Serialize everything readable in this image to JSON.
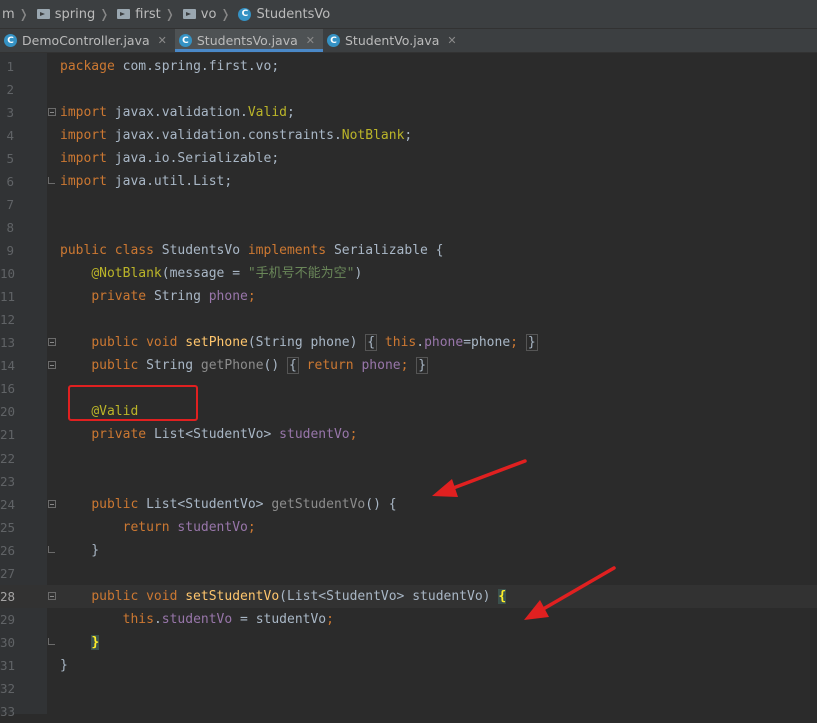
{
  "breadcrumb": [
    {
      "label": "m",
      "icon": "none"
    },
    {
      "label": "spring",
      "icon": "folder-icon"
    },
    {
      "label": "first",
      "icon": "folder-icon"
    },
    {
      "label": "vo",
      "icon": "folder-icon"
    },
    {
      "label": "StudentsVo",
      "icon": "class-icon"
    }
  ],
  "tabs": [
    {
      "label": "DemoController.java",
      "active": false
    },
    {
      "label": "StudentsVo.java",
      "active": true
    },
    {
      "label": "StudentVo.java",
      "active": false
    }
  ],
  "code": {
    "current_line": 28,
    "lines": [
      {
        "n": "1",
        "s": [
          [
            "kw",
            "package "
          ],
          [
            "gray",
            "com.spring.first.vo;"
          ]
        ]
      },
      {
        "n": "2",
        "s": []
      },
      {
        "n": "3",
        "fold": "open",
        "s": [
          [
            "kw",
            "import "
          ],
          [
            "gray",
            "javax.validation."
          ],
          [
            "an",
            "Valid"
          ],
          [
            "gray",
            ";"
          ]
        ]
      },
      {
        "n": "4",
        "s": [
          [
            "kw",
            "import "
          ],
          [
            "gray",
            "javax.validation.constraints."
          ],
          [
            "an",
            "NotBlank"
          ],
          [
            "gray",
            ";"
          ]
        ]
      },
      {
        "n": "5",
        "s": [
          [
            "kw",
            "import "
          ],
          [
            "gray",
            "java.io.Serializable;"
          ]
        ]
      },
      {
        "n": "6",
        "fold": "end",
        "s": [
          [
            "kw",
            "import "
          ],
          [
            "gray",
            "java.util.List;"
          ]
        ]
      },
      {
        "n": "7",
        "s": []
      },
      {
        "n": "8",
        "s": []
      },
      {
        "n": "9",
        "s": [
          [
            "kw",
            "public class "
          ],
          [
            "gray",
            "StudentsVo "
          ],
          [
            "kw",
            "implements "
          ],
          [
            "gray",
            "Serializable {"
          ]
        ]
      },
      {
        "n": "10",
        "s": [
          [
            "gray",
            "    "
          ],
          [
            "an",
            "@NotBlank"
          ],
          [
            "gray",
            "(message = "
          ],
          [
            "str",
            "\"手机号不能为空\""
          ],
          [
            "gray",
            ")"
          ]
        ]
      },
      {
        "n": "11",
        "s": [
          [
            "gray",
            "    "
          ],
          [
            "kw",
            "private "
          ],
          [
            "gray",
            "String "
          ],
          [
            "fd",
            "phone"
          ],
          [
            "kw",
            ";"
          ]
        ]
      },
      {
        "n": "12",
        "s": []
      },
      {
        "n": "13",
        "fold": "open",
        "s": [
          [
            "gray",
            "    "
          ],
          [
            "kw",
            "public void "
          ],
          [
            "fn",
            "setPhone"
          ],
          [
            "gray",
            "(String phone) "
          ],
          [
            "brace",
            "{"
          ],
          [
            "gray",
            " "
          ],
          [
            "kw",
            "this"
          ],
          [
            "gray",
            "."
          ],
          [
            "fd",
            "phone"
          ],
          [
            "gray",
            "=phone"
          ],
          [
            "kw",
            ";"
          ],
          [
            "gray",
            " "
          ],
          [
            "brace",
            "}"
          ]
        ]
      },
      {
        "n": "14",
        "fold": "open",
        "s": [
          [
            "gray",
            "    "
          ],
          [
            "kw",
            "public "
          ],
          [
            "gray",
            "String "
          ],
          [
            "mute",
            "getPhone"
          ],
          [
            "gray",
            "() "
          ],
          [
            "brace",
            "{"
          ],
          [
            "gray",
            " "
          ],
          [
            "kw",
            "return "
          ],
          [
            "fd",
            "phone"
          ],
          [
            "kw",
            ";"
          ],
          [
            "gray",
            " "
          ],
          [
            "brace",
            "}"
          ]
        ]
      },
      {
        "n": "16",
        "s": []
      },
      {
        "n": "20",
        "s": [
          [
            "gray",
            "    "
          ],
          [
            "an",
            "@Valid"
          ]
        ]
      },
      {
        "n": "21",
        "s": [
          [
            "gray",
            "    "
          ],
          [
            "kw",
            "private "
          ],
          [
            "gray",
            "List<StudentVo> "
          ],
          [
            "fd",
            "studentVo"
          ],
          [
            "kw",
            ";"
          ]
        ]
      },
      {
        "n": "22",
        "s": []
      },
      {
        "n": "23",
        "s": []
      },
      {
        "n": "24",
        "fold": "open",
        "s": [
          [
            "gray",
            "    "
          ],
          [
            "kw",
            "public "
          ],
          [
            "gray",
            "List<StudentVo> "
          ],
          [
            "mute",
            "getStudentVo"
          ],
          [
            "gray",
            "() {"
          ]
        ]
      },
      {
        "n": "25",
        "s": [
          [
            "gray",
            "        "
          ],
          [
            "kw",
            "return "
          ],
          [
            "fd",
            "studentVo"
          ],
          [
            "kw",
            ";"
          ]
        ]
      },
      {
        "n": "26",
        "fold": "end",
        "s": [
          [
            "gray",
            "    }"
          ]
        ]
      },
      {
        "n": "27",
        "s": []
      },
      {
        "n": "28",
        "fold": "open",
        "s": [
          [
            "gray",
            "    "
          ],
          [
            "kw",
            "public void "
          ],
          [
            "fn",
            "setStudentVo"
          ],
          [
            "gray",
            "(List<StudentVo> studentVo) "
          ],
          [
            "bmatch",
            "{"
          ]
        ]
      },
      {
        "n": "29",
        "s": [
          [
            "gray",
            "        "
          ],
          [
            "kw",
            "this"
          ],
          [
            "gray",
            "."
          ],
          [
            "fd",
            "studentVo"
          ],
          [
            "gray",
            " = studentVo"
          ],
          [
            "kw",
            ";"
          ]
        ]
      },
      {
        "n": "30",
        "fold": "end",
        "s": [
          [
            "gray",
            "    "
          ],
          [
            "bmatch",
            "}"
          ]
        ]
      },
      {
        "n": "31",
        "s": [
          [
            "gray",
            "}"
          ]
        ]
      },
      {
        "n": "32",
        "s": []
      },
      {
        "n": "33",
        "s": []
      }
    ]
  },
  "colors": {
    "highlight_box": "#e02020",
    "arrow": "#e02020"
  }
}
